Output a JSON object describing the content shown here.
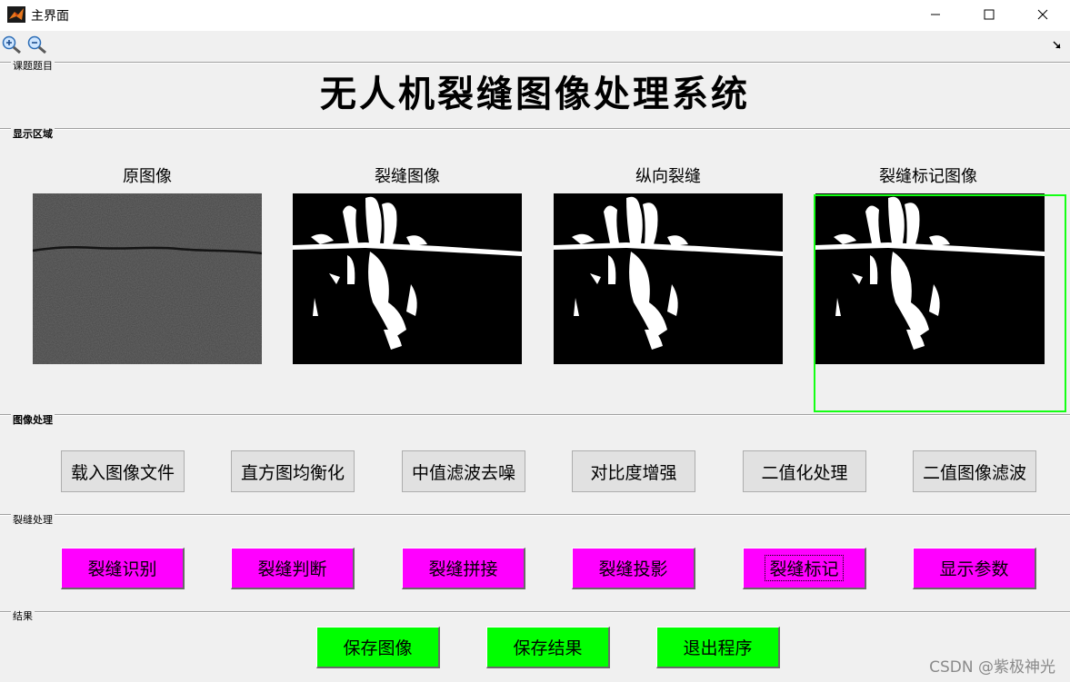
{
  "window": {
    "title": "主界面"
  },
  "panels": {
    "topic": "课题题目",
    "display": "显示区域",
    "image_processing": "图像处理",
    "crack_processing": "裂缝处理",
    "result": "结果"
  },
  "main_title": "无人机裂缝图像处理系统",
  "images": [
    {
      "caption": "原图像"
    },
    {
      "caption": "裂缝图像"
    },
    {
      "caption": "纵向裂缝"
    },
    {
      "caption": "裂缝标记图像"
    }
  ],
  "image_buttons": [
    "载入图像文件",
    "直方图均衡化",
    "中值滤波去噪",
    "对比度增强",
    "二值化处理",
    "二值图像滤波"
  ],
  "crack_buttons": [
    "裂缝识别",
    "裂缝判断",
    "裂缝拼接",
    "裂缝投影",
    "裂缝标记",
    "显示参数"
  ],
  "result_buttons": [
    "保存图像",
    "保存结果",
    "退出程序"
  ],
  "watermark": "CSDN @紫极神光",
  "colors": {
    "magenta": "#ff00ff",
    "green": "#00ff00",
    "selection": "#14ff14"
  }
}
